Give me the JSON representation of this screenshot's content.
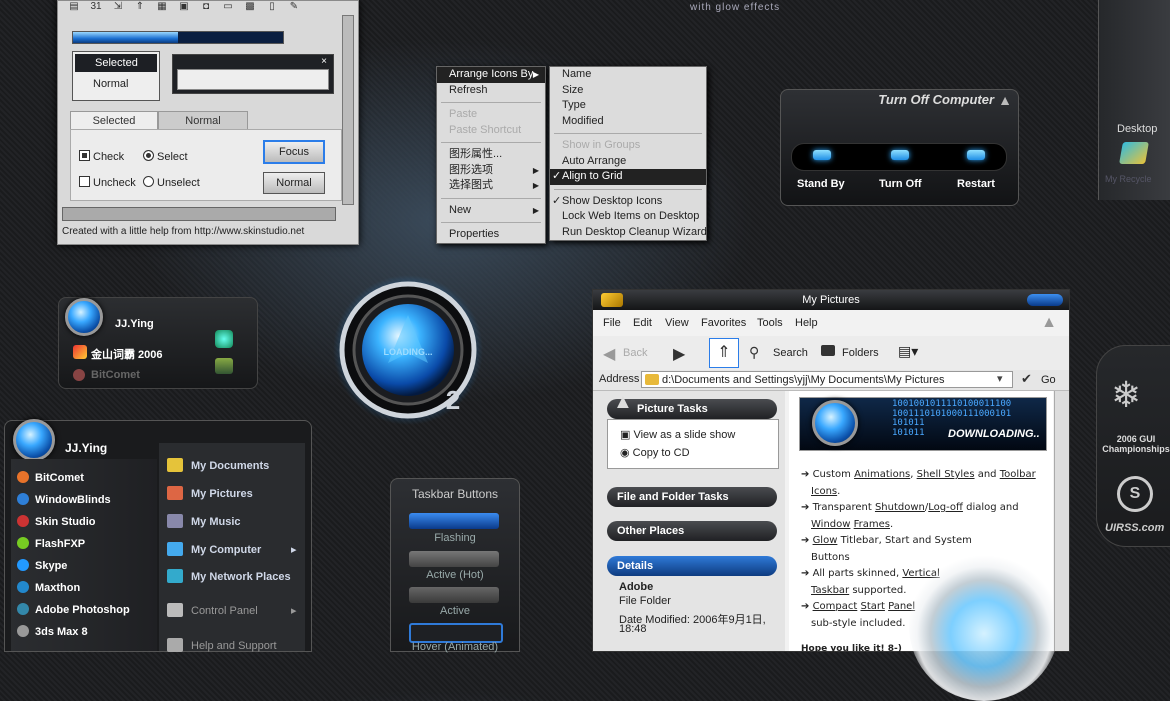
{
  "top_caption": "with glow effects",
  "skin_window": {
    "list_selected": "Selected",
    "list_normal": "Normal",
    "tab_selected": "Selected",
    "tab_normal": "Normal",
    "check_label": "Check",
    "uncheck_label": "Uncheck",
    "select_label": "Select",
    "unselect_label": "Unselect",
    "focus_button": "Focus",
    "normal_button": "Normal",
    "icon_31": "31",
    "close_x": "×",
    "status": "Created with a little help from http://www.skinstudio.net",
    "progress_fraction": 0.5
  },
  "context_menu": {
    "main": [
      {
        "label": "Arrange Icons By",
        "sub": true,
        "highlight": true
      },
      {
        "label": "Refresh"
      },
      {
        "sep": true
      },
      {
        "label": "Paste",
        "disabled": true
      },
      {
        "label": "Paste Shortcut",
        "disabled": true
      },
      {
        "sep": true
      },
      {
        "label": "图形属性..."
      },
      {
        "label": "图形选项",
        "sub": true
      },
      {
        "label": "选择图式",
        "sub": true
      },
      {
        "sep": true
      },
      {
        "label": "New",
        "sub": true
      },
      {
        "sep": true
      },
      {
        "label": "Properties"
      }
    ],
    "submenu": [
      {
        "label": "Name"
      },
      {
        "label": "Size"
      },
      {
        "label": "Type"
      },
      {
        "label": "Modified"
      },
      {
        "sep": true
      },
      {
        "label": "Show in Groups",
        "disabled": true
      },
      {
        "label": "Auto Arrange"
      },
      {
        "label": "Align to Grid",
        "checked": true,
        "highlight": true
      },
      {
        "sep": true
      },
      {
        "label": "Show Desktop Icons",
        "checked": true
      },
      {
        "label": "Lock Web Items on Desktop"
      },
      {
        "label": "Run Desktop Cleanup Wizard"
      }
    ]
  },
  "turn_off": {
    "title": "Turn Off Computer",
    "stand_by": "Stand By",
    "turn_off": "Turn Off",
    "restart": "Restart"
  },
  "right_strip": {
    "desktop_label": "Desktop",
    "recycle_label": "My Recycle",
    "championship": "2006 GUI Championships",
    "site": "UIRSS.com"
  },
  "user_panel": {
    "user": "JJ.Ying",
    "app1": "金山词霸 2006",
    "app2": "BitComet"
  },
  "loader": {
    "text": "LOADING...",
    "number": "2"
  },
  "start_menu": {
    "user": "JJ.Ying",
    "left_items": [
      "BitComet",
      "WindowBlinds",
      "Skin Studio",
      "FlashFXP",
      "Skype",
      "Maxthon",
      "Adobe Photoshop",
      "3ds Max 8"
    ],
    "left_colors": [
      "#e8732a",
      "#2e7fd8",
      "#c33",
      "#7c2",
      "#29f",
      "#28c",
      "#38a",
      "#999"
    ],
    "right_items": [
      {
        "label": "My Documents",
        "color": "#e5c33a"
      },
      {
        "label": "My Pictures",
        "color": "#d64"
      },
      {
        "label": "My Music",
        "color": "#88a"
      },
      {
        "label": "My Computer",
        "color": "#4ae",
        "sub": true
      },
      {
        "label": "My Network Places",
        "color": "#3ac"
      },
      {
        "label": "Control Panel",
        "color": "#bbb",
        "sub": true,
        "dim": true
      },
      {
        "label": "Help and Support",
        "color": "#aaa",
        "dim": true
      }
    ]
  },
  "taskbar": {
    "title": "Taskbar Buttons",
    "flashing": "Flashing",
    "active_hot": "Active (Hot)",
    "active": "Active",
    "hover": "Hover (Animated)"
  },
  "explorer": {
    "title": "My Pictures",
    "menu": [
      "File",
      "Edit",
      "View",
      "Favorites",
      "Tools",
      "Help"
    ],
    "back": "Back",
    "search": "Search",
    "folders": "Folders",
    "address_label": "Address",
    "address": "d:\\Documents and Settings\\yjj\\My Documents\\My Pictures",
    "go": "Go",
    "picture_tasks": "Picture Tasks",
    "view_slideshow": "View as a slide show",
    "copy_cd": "Copy to CD",
    "file_folder_tasks": "File and Folder Tasks",
    "other_places": "Other Places",
    "details": "Details",
    "detail_name": "Adobe",
    "detail_type": "File Folder",
    "detail_modified": "Date Modified: 2006年9月1日,",
    "detail_time": "18:48",
    "banner": "DOWNLOADING..",
    "banner_bits": [
      "1001001011110100011100",
      "1001110101000111000101",
      "101011",
      "101011"
    ],
    "features": [
      [
        "Custom ",
        "Animations",
        ", ",
        "Shell Styles",
        " and ",
        "Toolbar"
      ],
      [
        "Icons",
        "."
      ],
      [
        "Transparent ",
        "Shutdown",
        "/",
        "Log-off",
        " ",
        "dialog",
        " and"
      ],
      [
        "Window",
        " ",
        "Frames",
        "."
      ],
      [
        "Glow",
        " Titlebar, Start and System"
      ],
      [
        "Buttons"
      ],
      [
        "All parts skinned, ",
        "Vertical"
      ],
      [
        "Taskbar",
        " supported."
      ],
      [
        "Compact",
        " ",
        "Start",
        " ",
        "Panel"
      ],
      [
        "sub-style included."
      ]
    ],
    "closing": "Hope you like it!  8-)"
  }
}
